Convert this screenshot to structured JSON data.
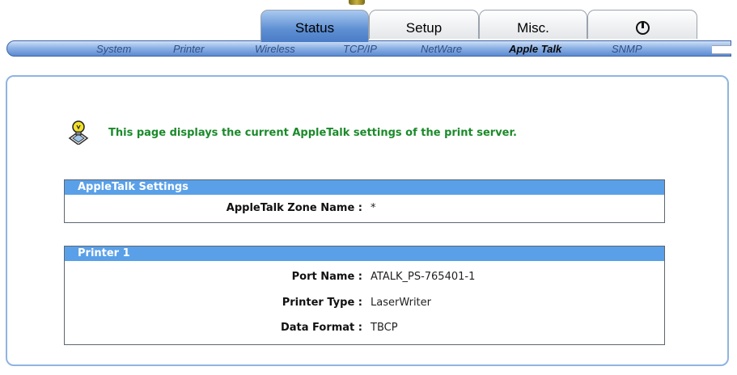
{
  "tabs": [
    {
      "label": "Status"
    },
    {
      "label": "Setup"
    },
    {
      "label": "Misc."
    },
    {
      "label": "",
      "icon": "power-icon"
    }
  ],
  "active_tab": "Status",
  "subnav": {
    "items": [
      "System",
      "Printer",
      "Wireless",
      "TCP/IP",
      "NetWare",
      "Apple Talk",
      "SNMP"
    ],
    "active": "Apple Talk"
  },
  "info": {
    "icon": "lightbulb-info-icon",
    "text": "This page displays the current AppleTalk settings of the print server."
  },
  "appletalk": {
    "header": "AppleTalk Settings",
    "zone_label": "AppleTalk Zone Name :",
    "zone_value": "*"
  },
  "printer1": {
    "header": "Printer 1",
    "port_label": "Port Name :",
    "port_value": "ATALK_PS-765401-1",
    "type_label": "Printer Type :",
    "type_value": "LaserWriter",
    "format_label": "Data Format :",
    "format_value": "TBCP"
  },
  "colors": {
    "accent_blue": "#5aa0e8",
    "info_green": "#1b8a2a"
  }
}
